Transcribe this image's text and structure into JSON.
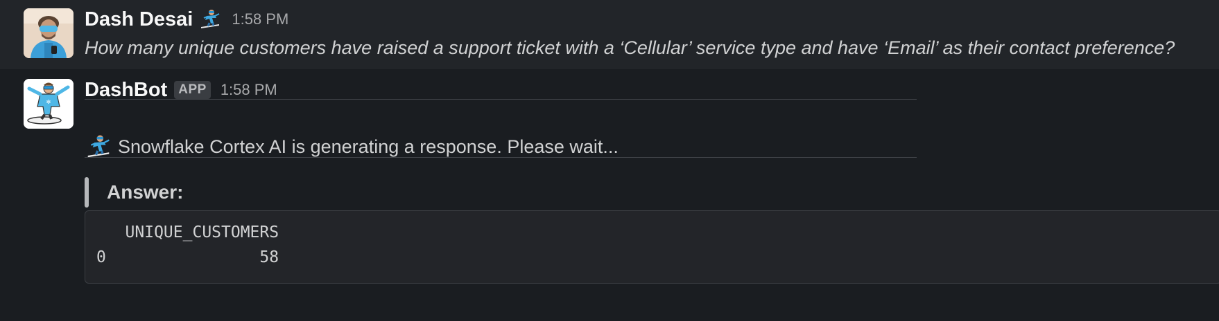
{
  "user_message": {
    "author": "Dash Desai",
    "time": "1:58 PM",
    "avatar": "user-avatar-photo",
    "status_emoji": "snowboarder-icon",
    "text": "How many unique customers have raised a support ticket with a ‘Cellular’ service type and have ‘Email’ as their contact preference?"
  },
  "bot_message": {
    "author": "DashBot",
    "badge": "APP",
    "time": "1:58 PM",
    "avatar": "snowboarder-bot-avatar",
    "status_icon": "snowboarder-icon",
    "status_text": "Snowflake Cortex AI is generating a response. Please wait...",
    "answer_label": "Answer:",
    "code_lines": [
      "   UNIQUE_CUSTOMERS",
      "0                58"
    ]
  },
  "colors": {
    "background": "#1a1d21",
    "highlight_row": "#222529",
    "text": "#d1d2d3",
    "author": "#f8f8f8",
    "muted": "#a8a9ab",
    "accent_blue": "#3ea8e0"
  }
}
